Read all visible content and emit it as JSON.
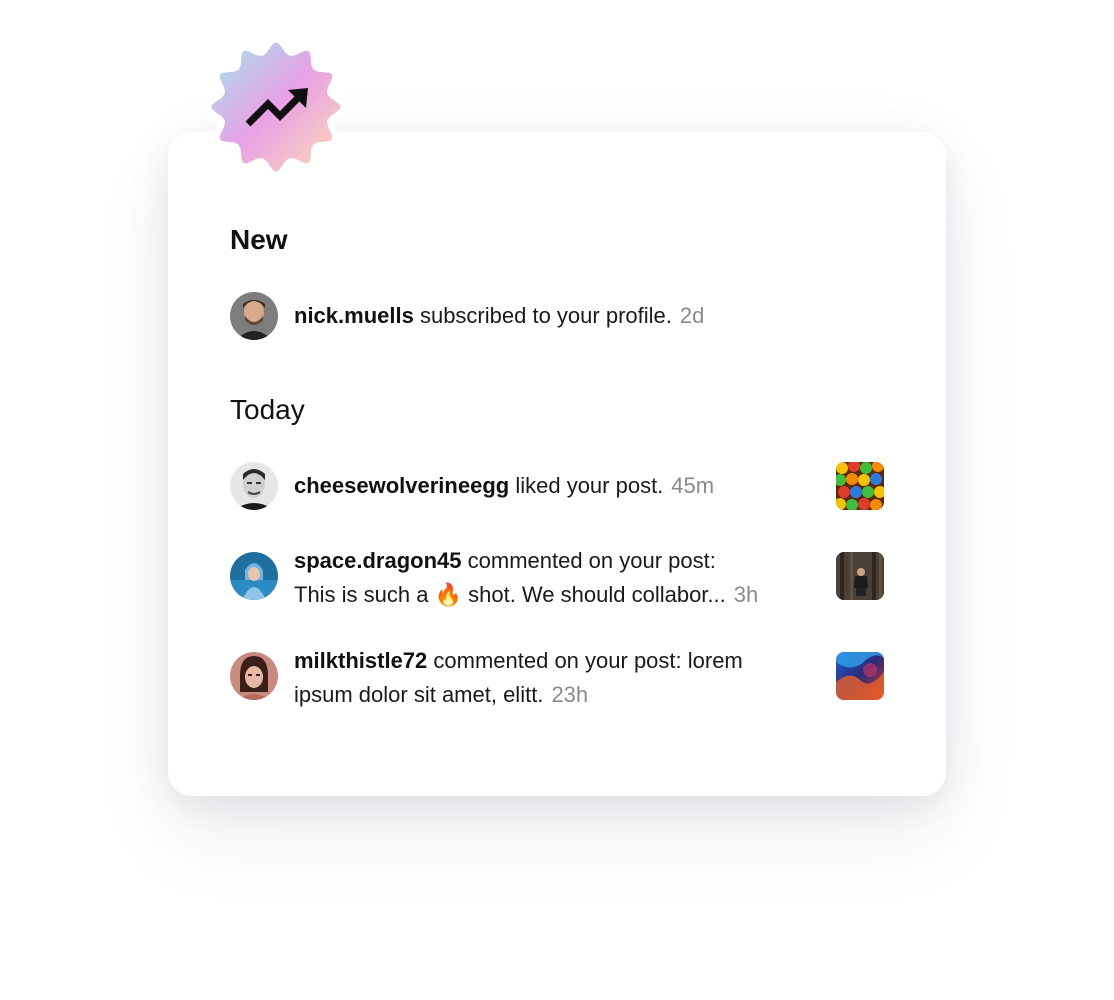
{
  "badge": {
    "icon": "trending-up-icon",
    "colors": [
      "#a8e6f0",
      "#e9a1e8",
      "#ffd8b5"
    ]
  },
  "sections": {
    "new_title": "New",
    "today_title": "Today"
  },
  "notifications": [
    {
      "username": "nick.muells",
      "message": " subscribed to your profile.",
      "time": "2d",
      "avatar": "avatar-nick-muells"
    },
    {
      "username": "cheesewolverineegg",
      "message": " liked your post.",
      "time": "45m",
      "avatar": "avatar-cheesewolverineegg",
      "thumbnail": "colorful-balls-thumbnail"
    },
    {
      "username": "space.dragon45",
      "message_line1": " commented on your post:",
      "message_line2_a": "This is such a ",
      "emoji": "🔥",
      "message_line2_b": " shot. We should collabor...",
      "time": "3h",
      "avatar": "avatar-space-dragon45",
      "thumbnail": "forest-person-thumbnail"
    },
    {
      "username": "milkthistle72",
      "message_line1": " commented on your post: lorem",
      "message_line2": "ipsum dolor sit amet, elitt.",
      "time": "23h",
      "avatar": "avatar-milkthistle72",
      "thumbnail": "colorful-smoke-thumbnail"
    }
  ]
}
